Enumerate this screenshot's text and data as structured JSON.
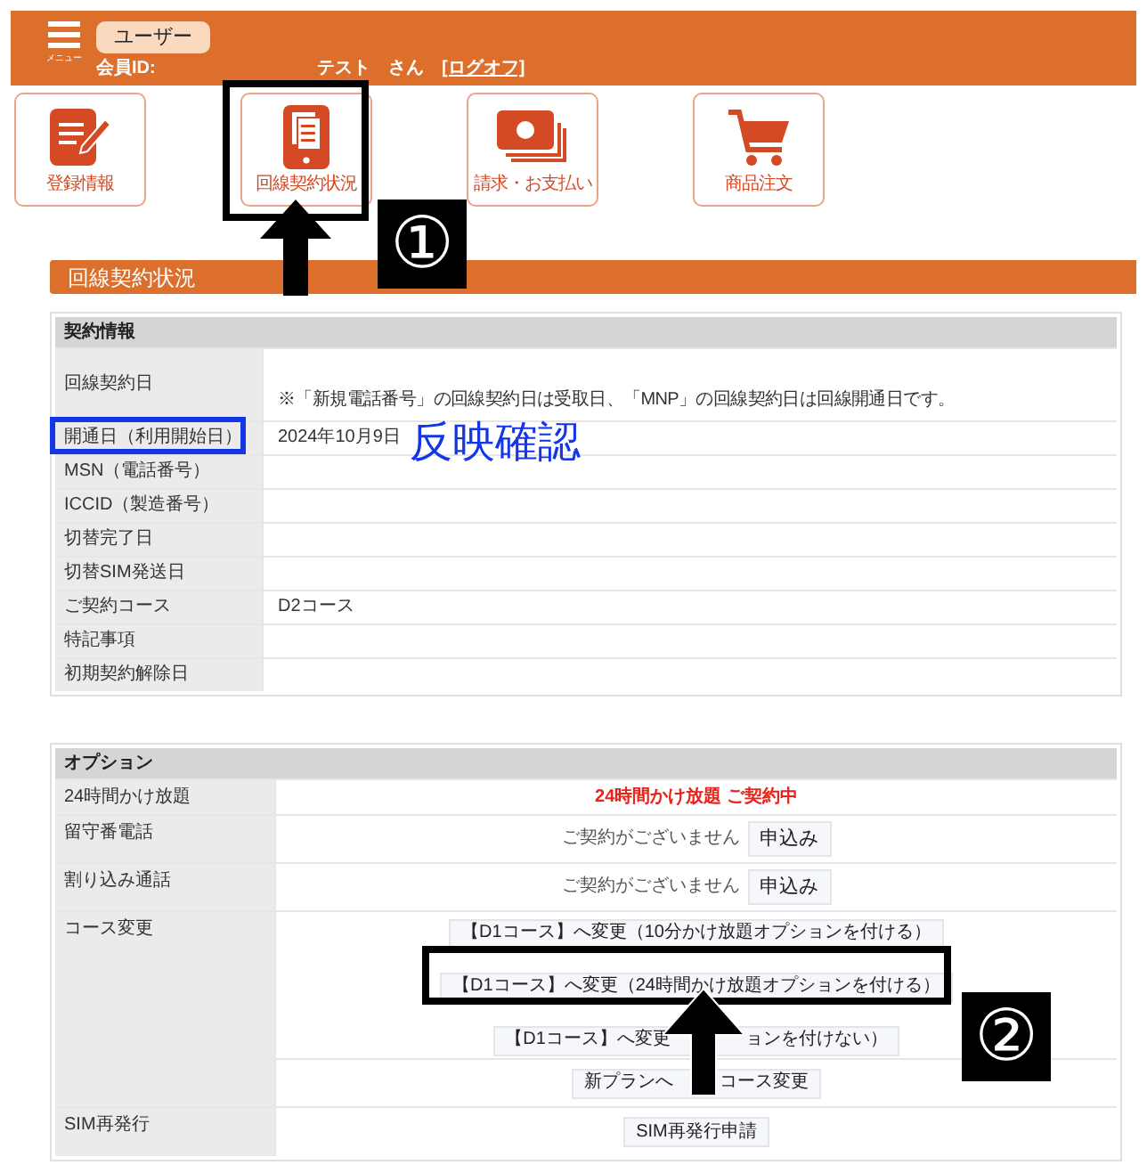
{
  "header": {
    "menu_label": "メニュー",
    "role": "ユーザー",
    "member_id_label": "会員ID:",
    "user_name": "テスト　さん",
    "logoff": "[ログオフ]"
  },
  "nav": [
    {
      "kind": "form",
      "label": "登録情報"
    },
    {
      "kind": "tablet",
      "label": "回線契約状況"
    },
    {
      "kind": "money",
      "label": "請求・お支払い"
    },
    {
      "kind": "cart",
      "label": "商品注文"
    }
  ],
  "section_title": "回線契約状況",
  "contract": {
    "title": "契約情報",
    "rows": [
      {
        "label": "回線契約日",
        "note": "※「新規電話番号」の回線契約日は受取日、「MNP」の回線契約日は回線開通日です。"
      },
      {
        "label": "開通日（利用開始日）",
        "value": "2024年10月9日"
      },
      {
        "label": "MSN（電話番号）"
      },
      {
        "label": "ICCID（製造番号）"
      },
      {
        "label": "切替完了日"
      },
      {
        "label": "切替SIM発送日"
      },
      {
        "label": "ご契約コース",
        "value": "D2コース"
      },
      {
        "label": "特記事項"
      },
      {
        "label": "初期契約解除日"
      }
    ]
  },
  "options": {
    "title": "オプション",
    "rows": [
      {
        "label": "24時間かけ放題",
        "groups": [
          [
            {
              "kind": "active",
              "text": "24時間かけ放題 ご契約中"
            }
          ]
        ]
      },
      {
        "label": "留守番電話",
        "groups": [
          [
            {
              "kind": "apply",
              "text": "ご契約がございません",
              "button": "申込み"
            }
          ]
        ]
      },
      {
        "label": "割り込み通話",
        "groups": [
          [
            {
              "kind": "apply",
              "text": "ご契約がございません",
              "button": "申込み"
            }
          ]
        ]
      },
      {
        "label": "コース変更",
        "groups": [
          [
            {
              "kind": "button",
              "parts": [
                "【D1コース】へ変更（10分かけ放題オプションを付ける）"
              ]
            },
            {
              "kind": "button",
              "parts": [
                "【D1コース】へ変更（24時間かけ放題オプションを付ける）"
              ]
            },
            {
              "kind": "button",
              "parts": [
                "【D1コース】へ変更",
                "ョンを付けない）"
              ]
            }
          ],
          [
            {
              "kind": "button",
              "parts": [
                "新プランへ",
                "コース変更"
              ]
            }
          ]
        ]
      },
      {
        "label": "SIM再発行",
        "groups": [
          [
            {
              "kind": "button",
              "parts": [
                "SIM再発行申請"
              ]
            }
          ]
        ]
      }
    ]
  },
  "annotations": {
    "step_1": "①",
    "step_2": "②",
    "note": "反映確認"
  }
}
